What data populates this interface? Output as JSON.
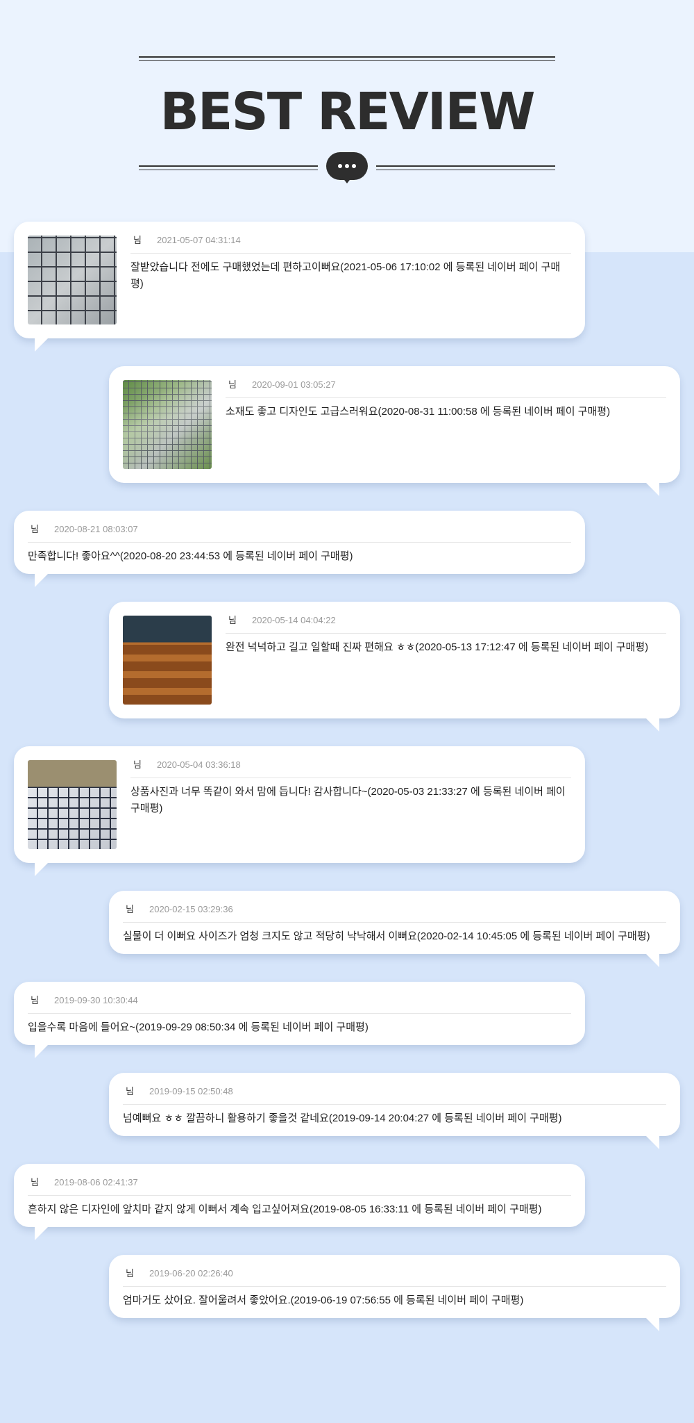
{
  "header": {
    "title": "BEST REVIEW"
  },
  "colors": {
    "page_background": "#d6e5fa",
    "header_background": "#ebf3fe",
    "title": "#2d2d2d",
    "date": "#999999"
  },
  "icons": {
    "chat_bubble": "speech-bubble-with-three-dots"
  },
  "reviews": [
    {
      "author": "님",
      "date": "2021-05-07 04:31:14",
      "text": "잘받았습니다 전에도 구매했었는데 편하고이뻐요(2021-05-06 17:10:02 에 등록된 네이버 페이 구매평)",
      "has_photo": true
    },
    {
      "author": "님",
      "date": "2020-09-01 03:05:27",
      "text": "소재도 좋고 디자인도 고급스러워요(2020-08-31 11:00:58 에 등록된 네이버 페이 구매평)",
      "has_photo": true
    },
    {
      "author": "님",
      "date": "2020-08-21 08:03:07",
      "text": "만족합니다! 좋아요^^(2020-08-20 23:44:53 에 등록된 네이버 페이 구매평)",
      "has_photo": false
    },
    {
      "author": "님",
      "date": "2020-05-14 04:04:22",
      "text": "완전 넉넉하고 길고 일할때 진짜 편해요 ㅎㅎ(2020-05-13 17:12:47 에 등록된 네이버 페이 구매평)",
      "has_photo": true
    },
    {
      "author": "님",
      "date": "2020-05-04 03:36:18",
      "text": "상품사진과 너무 똑같이 와서 맘에 듭니다! 감사합니다~(2020-05-03 21:33:27 에 등록된 네이버 페이 구매평)",
      "has_photo": true
    },
    {
      "author": "님",
      "date": "2020-02-15 03:29:36",
      "text": "실물이 더 이뻐요 사이즈가 엄청 크지도 않고 적당히 낙낙해서 이뻐요(2020-02-14 10:45:05 에 등록된 네이버 페이 구매평)",
      "has_photo": false
    },
    {
      "author": "님",
      "date": "2019-09-30 10:30:44",
      "text": "입을수록 마음에 들어요~(2019-09-29 08:50:34 에 등록된 네이버 페이 구매평)",
      "has_photo": false
    },
    {
      "author": "님",
      "date": "2019-09-15 02:50:48",
      "text": "넘예뻐요 ㅎㅎ 깔끔하니 활용하기 좋을것 같네요(2019-09-14 20:04:27 에 등록된 네이버 페이 구매평)",
      "has_photo": false
    },
    {
      "author": "님",
      "date": "2019-08-06 02:41:37",
      "text": "흔하지 않은 디자인에 앞치마 같지 않게 이뻐서 계속 입고싶어져요(2019-08-05 16:33:11 에 등록된 네이버 페이 구매평)",
      "has_photo": false
    },
    {
      "author": "님",
      "date": "2019-06-20 02:26:40",
      "text": "엄마거도 샀어요. 잘어울려서 좋았어요.(2019-06-19 07:56:55 에 등록된 네이버 페이 구매평)",
      "has_photo": false
    }
  ]
}
